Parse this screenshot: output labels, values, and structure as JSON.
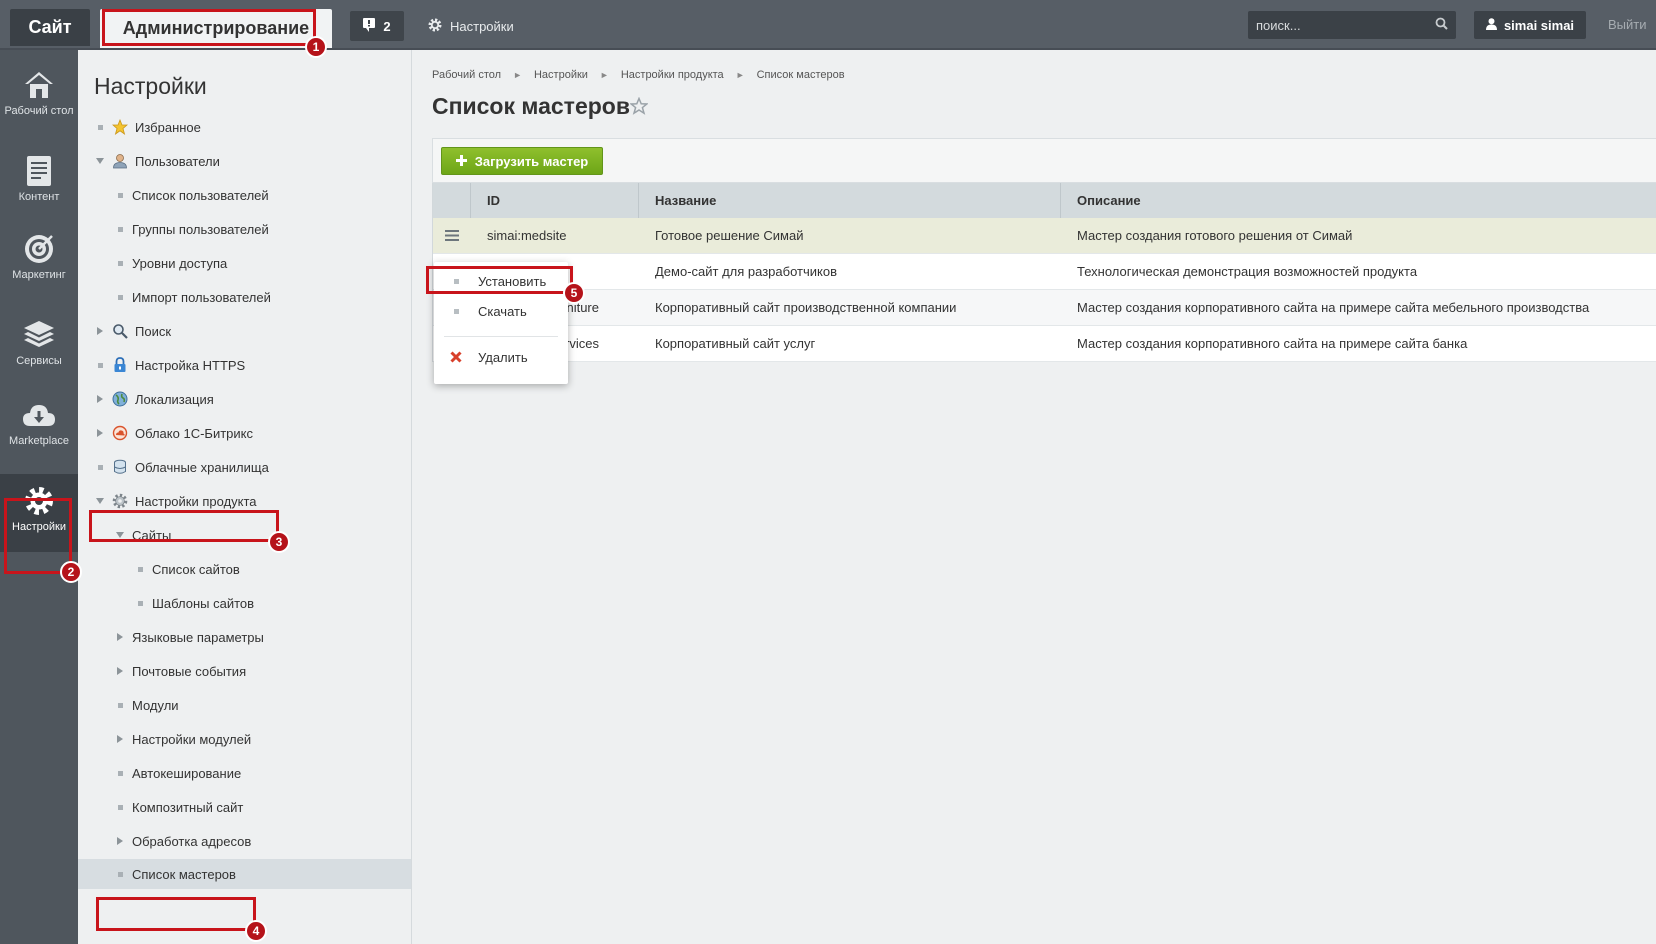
{
  "topbar": {
    "site_tab": "Сайт",
    "admin_tab": "Администрирование",
    "notifications_count": "2",
    "settings_label": "Настройки",
    "search_placeholder": "поиск...",
    "user_name": "simai simai",
    "logout_label": "Выйти"
  },
  "rail": [
    {
      "label": "Рабочий стол",
      "icon": "home-icon"
    },
    {
      "label": "Контент",
      "icon": "document-icon"
    },
    {
      "label": "Маркетинг",
      "icon": "target-icon"
    },
    {
      "label": "Сервисы",
      "icon": "layers-icon"
    },
    {
      "label": "Marketplace",
      "icon": "cloud-download-icon"
    },
    {
      "label": "Настройки",
      "icon": "gear-icon",
      "active": true
    }
  ],
  "menu": {
    "title": "Настройки",
    "items": [
      "Избранное",
      "Пользователи",
      "Список пользователей",
      "Группы пользователей",
      "Уровни доступа",
      "Импорт пользователей",
      "Поиск",
      "Настройка HTTPS",
      "Локализация",
      "Облако 1С-Битрикс",
      "Облачные хранилища",
      "Настройки продукта",
      "Сайты",
      "Список сайтов",
      "Шаблоны сайтов",
      "Языковые параметры",
      "Почтовые события",
      "Модули",
      "Настройки модулей",
      "Автокеширование",
      "Композитный сайт",
      "Обработка адресов",
      "Список мастеров"
    ]
  },
  "breadcrumb": [
    "Рабочий стол",
    "Настройки",
    "Настройки продукта",
    "Список мастеров"
  ],
  "page_title": "Список мастеров",
  "upload_button": "Загрузить мастер",
  "table": {
    "headers": [
      "ID",
      "Название",
      "Описание"
    ],
    "rows": [
      {
        "id": "simai:medsite",
        "name": "Готовое решение Симай",
        "desc": "Мастер создания готового решения от Симай"
      },
      {
        "id": "",
        "name": "Демо-сайт для разработчиков",
        "desc": "Технологическая демонстрация возможностей продукта"
      },
      {
        "id": "niture",
        "name": "Корпоративный сайт производственной компании",
        "desc": "Мастер создания корпоративного сайта на примере сайта мебельного производства"
      },
      {
        "id": "rvices",
        "name": "Корпоративный сайт услуг",
        "desc": "Мастер создания корпоративного сайта на примере сайта банка"
      }
    ]
  },
  "context_menu": [
    "Установить",
    "Скачать",
    "Удалить"
  ],
  "annotations": [
    "1",
    "2",
    "3",
    "4",
    "5"
  ],
  "colors": {
    "accent_red": "#c8141b",
    "button_green": "#7cb323",
    "topbar": "#575e66"
  }
}
